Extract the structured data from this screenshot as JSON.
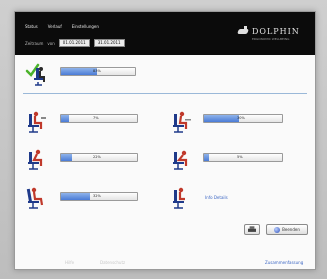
{
  "nav": {
    "items": [
      "Status",
      "Verlauf",
      "Einstellungen"
    ]
  },
  "filters": {
    "label_from": "Zeitraum",
    "label_sep": "von",
    "from_value": "01.01.2011",
    "to_value": "31.01.2011"
  },
  "brand": {
    "name": "DOLPHIN",
    "tagline": "ERGONOMIC WELLBEING"
  },
  "summary": {
    "value": "83%",
    "level": 0.48
  },
  "postures": [
    {
      "value": "7%",
      "level": 0.1
    },
    {
      "value": "22%",
      "level": 0.15
    },
    {
      "value": "32%",
      "level": 0.38
    },
    {
      "value": "30%",
      "level": 0.45
    },
    {
      "value": "5%",
      "level": 0.06
    }
  ],
  "links": {
    "details": "Info Details",
    "footer": "Zusammenfassung"
  },
  "buttons": {
    "print": "",
    "start": "Beenden"
  },
  "footer_faint": [
    "Hilfe",
    "Datenschutz"
  ],
  "colors": {
    "accent": "#4a7bd6",
    "figure": "#c0392b",
    "chair": "#1f3a8a"
  }
}
